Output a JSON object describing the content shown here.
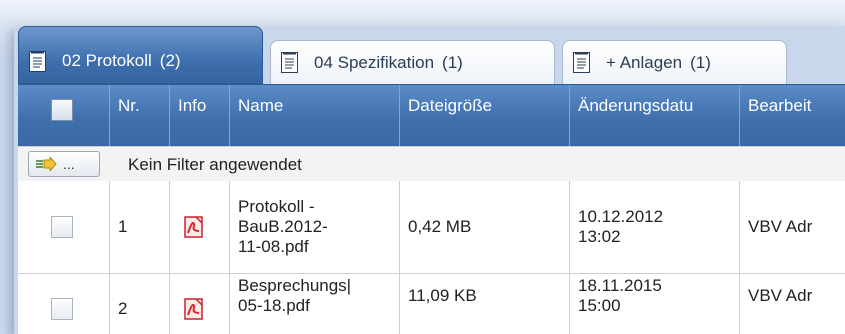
{
  "tabs": [
    {
      "label": "02 Protokoll",
      "count": "(2)"
    },
    {
      "label": "04 Spezifikation",
      "count": "(1)"
    },
    {
      "label": "+ Anlagen",
      "count": "(1)"
    }
  ],
  "columns": {
    "nr": "Nr.",
    "info": "Info",
    "name": "Name",
    "size": "Dateigröße",
    "changed": "Änderungsdatu",
    "editor": "Bearbeit"
  },
  "filter": {
    "button_label": "...",
    "status": "Kein Filter angewendet"
  },
  "rows": [
    {
      "nr": "1",
      "name_lines": [
        "Protokoll -",
        "BauB.2012-",
        "11-08.pdf"
      ],
      "size": "0,42 MB",
      "date": "10.12.2012",
      "time": "13:02",
      "editor": "VBV Adr"
    },
    {
      "nr": "2",
      "name_lines": [
        "Besprechungs|",
        "05-18.pdf"
      ],
      "size": "11,09 KB",
      "date": "18.11.2015",
      "time": "15:00",
      "editor": "VBV Adr"
    }
  ],
  "icons": {
    "tab": "document-icon",
    "file": "pdf-file-icon",
    "filter": "filter-arrow-icon"
  },
  "colors": {
    "header": "#3f70ad",
    "active_tab": "#3e6fae",
    "pdf": "#d9262c"
  }
}
